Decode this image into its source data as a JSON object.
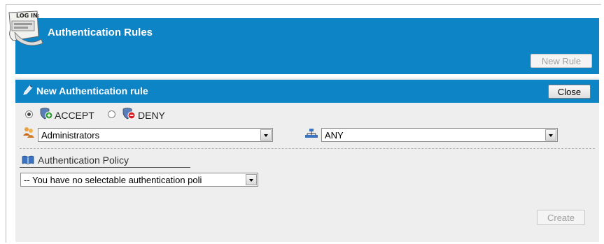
{
  "header": {
    "title": "Authentication Rules",
    "login_icon_text": "LOG IN:",
    "new_rule_label": "New Rule"
  },
  "panel": {
    "title": "New Authentication rule",
    "close_label": "Close"
  },
  "rule_type": {
    "accept_label": "ACCEPT",
    "deny_label": "DENY",
    "selected": "ACCEPT"
  },
  "group_select": {
    "value": "Administrators"
  },
  "network_select": {
    "value": "ANY"
  },
  "policy": {
    "label": "Authentication Policy",
    "select_value": "-- You have no selectable authentication poli"
  },
  "footer": {
    "create_label": "Create"
  },
  "colors": {
    "header_blue": "#0d84c6",
    "panel_bg": "#eeeeee",
    "accept_green": "#2e9c2e",
    "deny_red": "#d32020"
  }
}
